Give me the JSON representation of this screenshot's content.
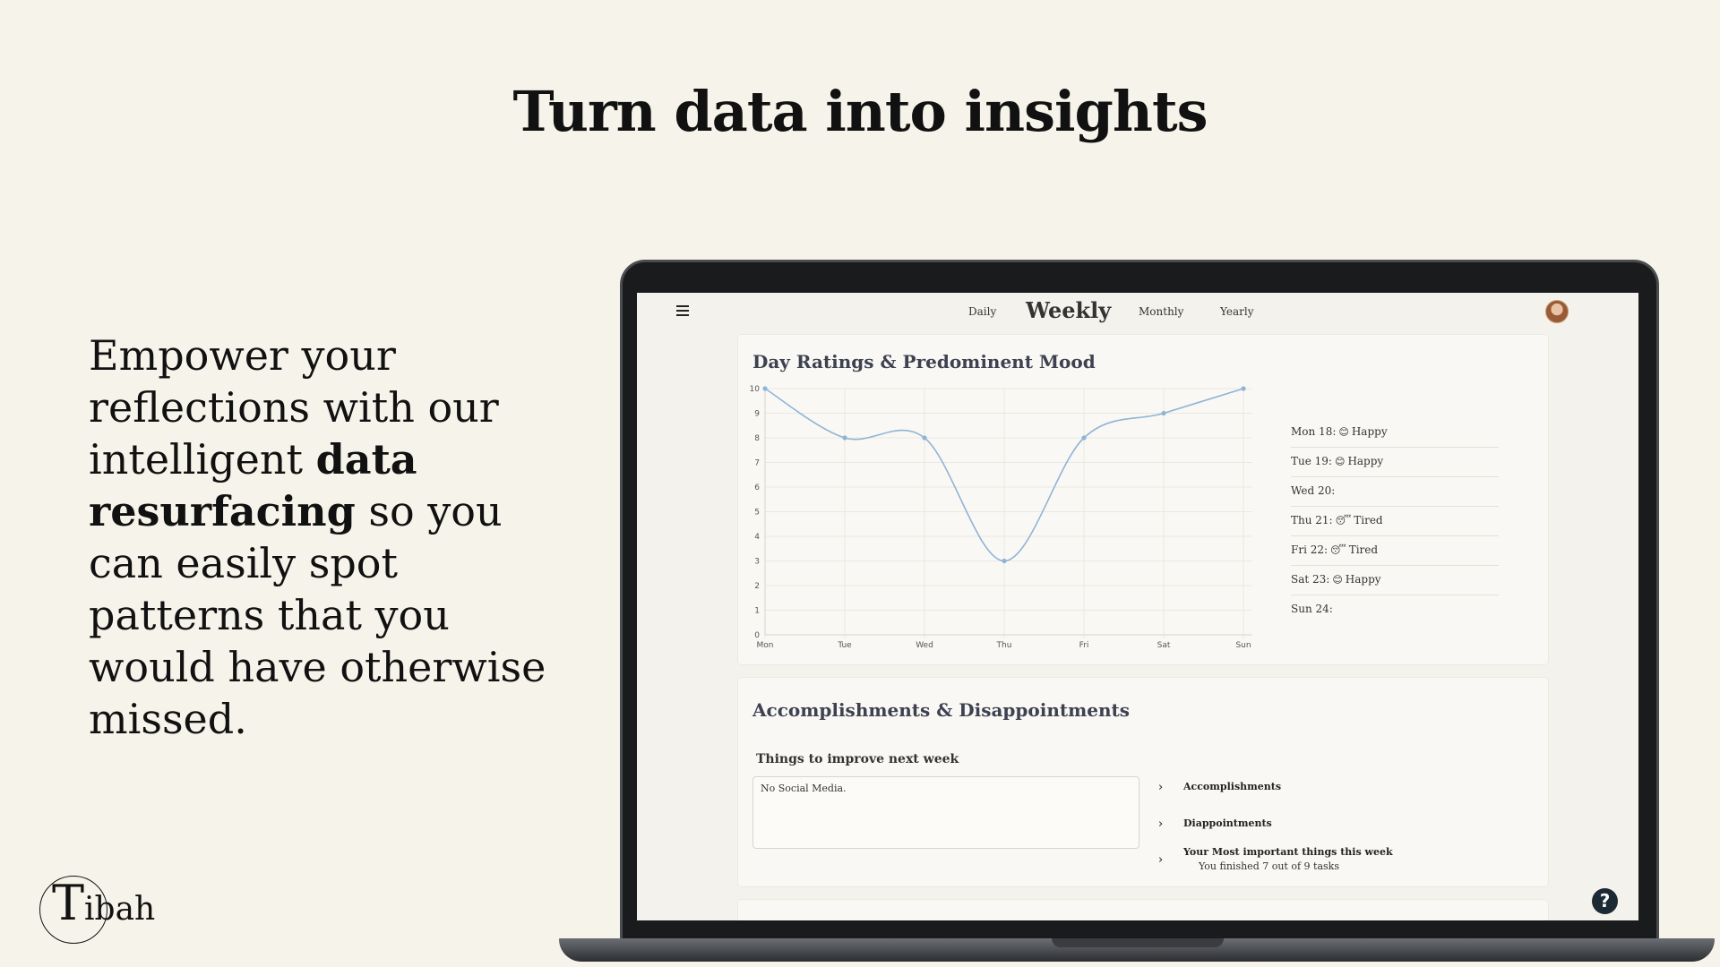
{
  "headline": "Turn data into insights",
  "pitch": {
    "part1": "Empower your reflections with our intelligent ",
    "bold": "data resurfacing",
    "part2": " so you can easily spot patterns that you would have otherwise missed."
  },
  "brand": {
    "letter": "T",
    "rest": "ibah"
  },
  "app": {
    "nav": {
      "daily": "Daily",
      "weekly": "Weekly",
      "monthly": "Monthly",
      "yearly": "Yearly"
    },
    "ratings_card": {
      "title": "Day Ratings & Predominent Mood",
      "moods": [
        {
          "day": "Mon 18:",
          "emoji": "😊",
          "mood": "Happy"
        },
        {
          "day": "Tue 19:",
          "emoji": "😊",
          "mood": "Happy"
        },
        {
          "day": "Wed 20:",
          "emoji": "",
          "mood": ""
        },
        {
          "day": "Thu 21:",
          "emoji": "😴",
          "mood": "Tired"
        },
        {
          "day": "Fri 22:",
          "emoji": "😴",
          "mood": "Tired"
        },
        {
          "day": "Sat 23:",
          "emoji": "😊",
          "mood": "Happy"
        },
        {
          "day": "Sun 24:",
          "emoji": "",
          "mood": ""
        }
      ]
    },
    "acc_card": {
      "title": "Accomplishments  &  Disappointments",
      "improve_label": "Things to improve next week",
      "improve_text": "No Social Media.",
      "items": {
        "accomplishments": "Accomplishments",
        "disappointments": "Diappointments",
        "important": "Your Most important things this week",
        "important_sub": "You finished 7 out of 9 tasks"
      }
    },
    "help_label": "?"
  },
  "colors": {
    "line": "#8fb4d6",
    "background": "#f6f4ea",
    "help": "#1c2a33"
  },
  "chart_data": {
    "type": "line",
    "categories": [
      "Mon",
      "Tue",
      "Wed",
      "Thu",
      "Fri",
      "Sat",
      "Sun"
    ],
    "values": [
      10,
      8,
      8,
      3,
      8,
      9,
      10
    ],
    "ylim": [
      0,
      10
    ],
    "yticks": [
      0,
      1,
      2,
      3,
      4,
      5,
      6,
      7,
      8,
      9,
      10
    ],
    "grid": true,
    "title": "",
    "xlabel": "",
    "ylabel": ""
  }
}
